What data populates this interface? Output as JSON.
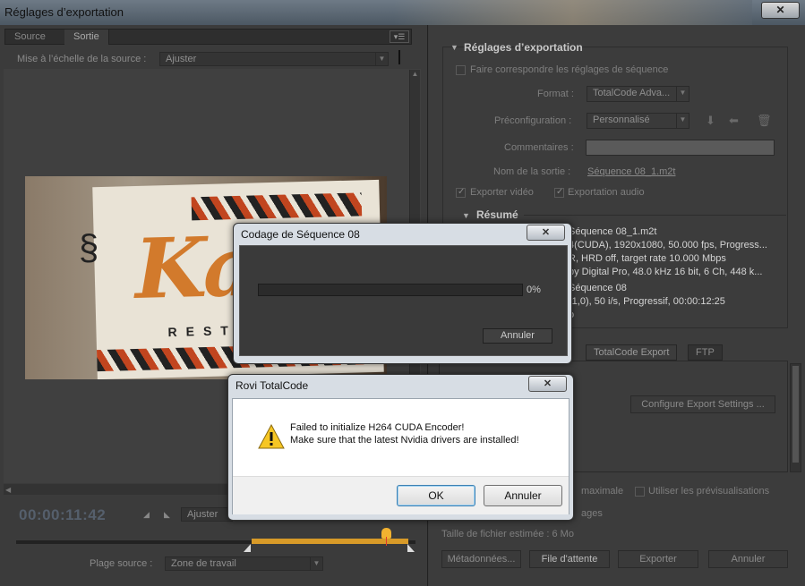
{
  "window": {
    "title": "Réglages d’exportation",
    "close_glyph": "✕"
  },
  "left": {
    "tabs": [
      "Source",
      "Sortie"
    ],
    "scale_label": "Mise à l’échelle de la source :",
    "scale_value": "Ajuster",
    "timecode": "00:00:11:42",
    "fit_value": "Ajuster",
    "range_label": "Plage source :",
    "range_value": "Zone de travail",
    "video_text": {
      "logo": "Kadi",
      "sub": "RESTAUR"
    }
  },
  "right": {
    "section_title": "Réglages d’exportation",
    "match_sequence": "Faire correspondre les réglages de séquence",
    "format_label": "Format :",
    "format_value": "TotalCode Adva...",
    "preset_label": "Préconfiguration :",
    "preset_value": "Personnalisé",
    "comments_label": "Commentaires :",
    "output_label": "Nom de la sortie :",
    "output_value": "Séquence 08_1.m2t",
    "export_video": "Exporter vidéo",
    "export_audio": "Exportation audio",
    "summary_title": "Résumé",
    "summary_output_lines": [
      "Séquence 08_1.m2t",
      "4(CUDA), 1920x1080, 50.000 fps, Progress...",
      "R, HRD off, target rate 10.000 Mbps",
      "by Digital Pro, 48.0 kHz 16 bit, 6 Ch, 448 k..."
    ],
    "summary_source_lines": [
      "Séquence 08",
      "(1,0), 50  i/s, Progressif, 00:00:12:25",
      "o"
    ],
    "tabs": [
      "TotalCode Export",
      "FTP"
    ],
    "configure_button": "Configure Export Settings ...",
    "max_label": "maximale",
    "use_previews": "Utiliser les prévisualisations",
    "ages_label": "ages",
    "filesize": "Taille de fichier estimée :  6 Mo",
    "buttons": [
      "Métadonnées...",
      "File d'attente",
      "Exporter",
      "Annuler"
    ]
  },
  "codage": {
    "title": "Codage de Séquence 08",
    "progress_percent": 0,
    "progress_text": "0%",
    "cancel": "Annuler"
  },
  "rovi": {
    "title": "Rovi TotalCode",
    "line1": "Failed to initialize H264 CUDA Encoder!",
    "line2": "Make sure that the latest Nvidia drivers are installed!",
    "ok": "OK",
    "cancel": "Annuler"
  },
  "colors": {
    "accent": "#d89a28",
    "timecode": "#555f6c"
  }
}
